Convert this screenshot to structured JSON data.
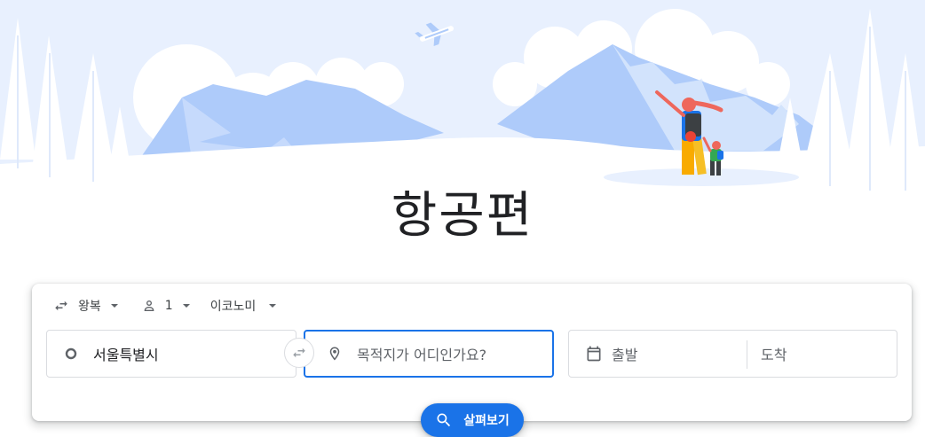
{
  "page": {
    "title": "항공편"
  },
  "search": {
    "trip_type": "왕복",
    "passengers": "1",
    "cabin_class": "이코노미",
    "origin": {
      "value": "서울특별시"
    },
    "destination": {
      "placeholder": "목적지가 어디인가요?"
    },
    "departure": {
      "placeholder": "출발"
    },
    "return": {
      "placeholder": "도착"
    },
    "search_button_label": "살펴보기"
  },
  "colors": {
    "accent": "#1a73e8",
    "sky": "#e8f0fe",
    "mountain": "#aecbfa"
  },
  "icons": [
    "swap-arrows-icon",
    "caret-down-icon",
    "person-icon",
    "origin-circle-icon",
    "swap-icon",
    "location-pin-icon",
    "calendar-icon",
    "search-icon",
    "airplane-icon"
  ]
}
